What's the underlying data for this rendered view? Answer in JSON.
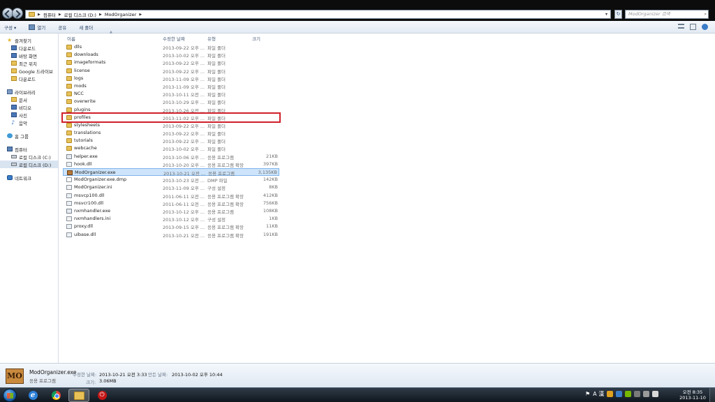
{
  "address": {
    "crumbs": [
      "컴퓨터",
      "로컬 디스크 (D:)",
      "ModOrganizer"
    ]
  },
  "search": {
    "placeholder": "ModOrganizer 검색"
  },
  "toolbar": {
    "organize": "구성 ▾",
    "open": "열기",
    "share": "공유",
    "new_folder": "새 폴더"
  },
  "columns": {
    "name": "이름",
    "date": "수정한 날짜",
    "type": "유형",
    "size": "크기"
  },
  "nav": {
    "favorites": "즐겨찾기",
    "downloads": "다운로드",
    "desktop": "바탕 화면",
    "recent": "최근 위치",
    "gdrive": "Google 드라이브",
    "downloads2": "다운로드",
    "libraries": "라이브러리",
    "documents": "문서",
    "videos": "비디오",
    "pictures": "사진",
    "music": "음악",
    "homegroup": "홈 그룹",
    "computer": "컴퓨터",
    "disk_c": "로컬 디스크 (C:)",
    "disk_d": "로컬 디스크 (D:)",
    "network": "네트워크"
  },
  "files": [
    {
      "name": "dlls",
      "date": "2013-09-22 오후 ...",
      "type": "파일 폴더",
      "size": "",
      "icon": "folder"
    },
    {
      "name": "downloads",
      "date": "2013-10-02 오후 ...",
      "type": "파일 폴더",
      "size": "",
      "icon": "folder"
    },
    {
      "name": "imageformats",
      "date": "2013-09-22 오후 ...",
      "type": "파일 폴더",
      "size": "",
      "icon": "folder"
    },
    {
      "name": "license",
      "date": "2013-09-22 오후 ...",
      "type": "파일 폴더",
      "size": "",
      "icon": "folder"
    },
    {
      "name": "logs",
      "date": "2013-11-09 오후 ...",
      "type": "파일 폴더",
      "size": "",
      "icon": "folder"
    },
    {
      "name": "mods",
      "date": "2013-11-09 오후 ...",
      "type": "파일 폴더",
      "size": "",
      "icon": "folder"
    },
    {
      "name": "NCC",
      "date": "2013-10-11 오전 ...",
      "type": "파일 폴더",
      "size": "",
      "icon": "folder"
    },
    {
      "name": "overwrite",
      "date": "2013-10-29 오후 ...",
      "type": "파일 폴더",
      "size": "",
      "icon": "folder"
    },
    {
      "name": "plugins",
      "date": "2013-10-26 오전 ...",
      "type": "파일 폴더",
      "size": "",
      "icon": "folder"
    },
    {
      "name": "profiles",
      "date": "2013-11-02 오후 ...",
      "type": "파일 폴더",
      "size": "",
      "icon": "folder"
    },
    {
      "name": "stylesheets",
      "date": "2013-09-22 오후 ...",
      "type": "파일 폴더",
      "size": "",
      "icon": "folder"
    },
    {
      "name": "translations",
      "date": "2013-09-22 오후 ...",
      "type": "파일 폴더",
      "size": "",
      "icon": "folder"
    },
    {
      "name": "tutorials",
      "date": "2013-09-22 오후 ...",
      "type": "파일 폴더",
      "size": "",
      "icon": "folder"
    },
    {
      "name": "webcache",
      "date": "2013-10-02 오후 ...",
      "type": "파일 폴더",
      "size": "",
      "icon": "folder"
    },
    {
      "name": "helper.exe",
      "date": "2013-10-06 오후 ...",
      "type": "응용 프로그램",
      "size": "21KB",
      "icon": "exe"
    },
    {
      "name": "hook.dll",
      "date": "2013-10-20 오후 ...",
      "type": "응용 프로그램 확장",
      "size": "397KB",
      "icon": "dll"
    },
    {
      "name": "ModOrganizer.exe",
      "date": "2013-10-21 오전 ...",
      "type": "응용 프로그램",
      "size": "3,135KB",
      "icon": "mo"
    },
    {
      "name": "ModOrganizer.exe.dmp",
      "date": "2013-10-23 오전 ...",
      "type": "DMP 파일",
      "size": "142KB",
      "icon": "file"
    },
    {
      "name": "ModOrganizer.ini",
      "date": "2013-11-09 오후 ...",
      "type": "구성 설정",
      "size": "8KB",
      "icon": "ini"
    },
    {
      "name": "msvcp100.dll",
      "date": "2011-06-11 오전 ...",
      "type": "응용 프로그램 확장",
      "size": "412KB",
      "icon": "dll"
    },
    {
      "name": "msvcr100.dll",
      "date": "2011-06-11 오전 ...",
      "type": "응용 프로그램 확장",
      "size": "756KB",
      "icon": "dll"
    },
    {
      "name": "nxmhandler.exe",
      "date": "2013-10-12 오후 ...",
      "type": "응용 프로그램",
      "size": "108KB",
      "icon": "exe"
    },
    {
      "name": "nxmhandlers.ini",
      "date": "2013-10-12 오후 ...",
      "type": "구성 설정",
      "size": "1KB",
      "icon": "ini"
    },
    {
      "name": "proxy.dll",
      "date": "2013-09-15 오후 ...",
      "type": "응용 프로그램 확장",
      "size": "11KB",
      "icon": "dll"
    },
    {
      "name": "uibase.dll",
      "date": "2013-10-21 오전 ...",
      "type": "응용 프로그램 확장",
      "size": "191KB",
      "icon": "dll"
    }
  ],
  "selected_row": 16,
  "highlighted_row": 9,
  "details": {
    "icon_text": "MO",
    "name": "ModOrganizer.exe",
    "kind": "응용 프로그램",
    "modified_label": "수정한 날짜:",
    "modified_value": "2013-10-21 오전 3:33",
    "created_label": "만든 날짜:",
    "created_value": "2013-10-02 오후 10:44",
    "size_label": "크기:",
    "size_value": "3.06MB"
  },
  "taskbar": {
    "clock_time": "오전 8:35",
    "clock_date": "2013-11-10",
    "ime": "A 漢"
  },
  "colors": {
    "highlight_box": "#d0202a",
    "selection": "#cde4fa"
  }
}
